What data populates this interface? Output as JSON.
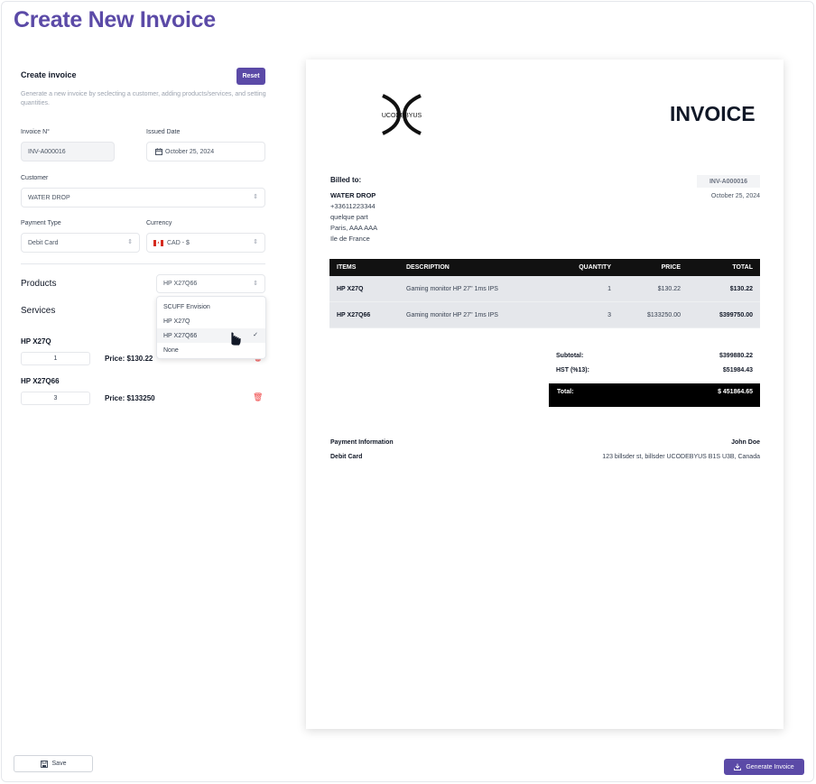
{
  "page_title": "Create New Invoice",
  "form": {
    "section_title": "Create invoice",
    "reset_label": "Reset",
    "description": "Generate a new invoice by seclecting a customer, adding products/services, and setting quantities.",
    "invoice_no_label": "Invoice N°",
    "invoice_no_value": "INV-A000016",
    "issued_date_label": "Issued Date",
    "issued_date_value": "October 25, 2024",
    "customer_label": "Customer",
    "customer_value": "WATER DROP",
    "payment_type_label": "Payment Type",
    "payment_type_value": "Debit Card",
    "currency_label": "Currency",
    "currency_value": "CAD - $",
    "products_label": "Products",
    "products_selected": "HP X27Q66",
    "services_label": "Services",
    "dropdown_options": [
      "SCUFF Envision",
      "HP X27Q",
      "HP X27Q66",
      "None"
    ],
    "dropdown_selected_index": 2,
    "items": [
      {
        "name": "HP X27Q",
        "qty": "1",
        "price": "Price: $130.22"
      },
      {
        "name": "HP X27Q66",
        "qty": "3",
        "price": "Price: $133250"
      }
    ]
  },
  "buttons": {
    "save_label": "Save",
    "generate_label": "Generate Invoice"
  },
  "invoice": {
    "logo_text": "UCODEBYUS",
    "title": "INVOICE",
    "billed_to_label": "Billed to:",
    "customer_name": "WATER DROP",
    "phone": "+33611223344",
    "address_lines": [
      "quelque part",
      "Paris, AAA AAA",
      "Ile de France"
    ],
    "number": "INV-A000016",
    "date": "October 25, 2024",
    "table_headers": [
      "ITEMS",
      "DESCRIPTION",
      "QUANTITY",
      "PRICE",
      "TOTAL"
    ],
    "rows": [
      {
        "item": "HP X27Q",
        "description": "Gaming monitor HP 27\" 1ms IPS",
        "quantity": "1",
        "price": "$130.22",
        "total": "$130.22"
      },
      {
        "item": "HP X27Q66",
        "description": "Gaming monitor HP 27\" 1ms IPS",
        "quantity": "3",
        "price": "$133250.00",
        "total": "$399750.00"
      }
    ],
    "subtotal_label": "Subtotal:",
    "subtotal_value": "$399880.22",
    "tax_label": "HST (%13):",
    "tax_value": "$51984.43",
    "total_label": "Total:",
    "total_value": "$ 451864.65",
    "payment_info_label": "Payment Information",
    "payment_method": "Debit Card",
    "payee_name": "John Doe",
    "payee_address": "123 billsder st, billsder UCODEBYUS B1S U3B, Canada"
  },
  "colors": {
    "accent": "#5b4aa7",
    "danger": "#ef4444"
  }
}
